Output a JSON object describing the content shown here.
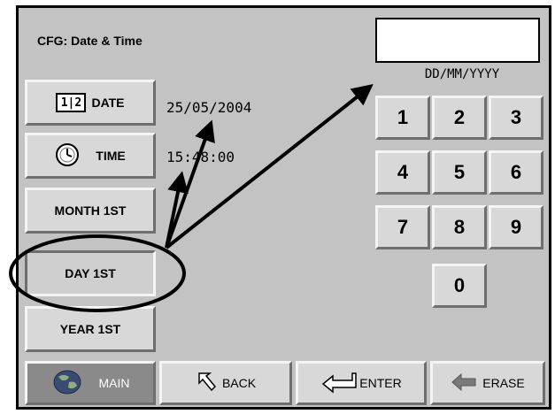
{
  "screen": {
    "title": "CFG: Date & Time",
    "entry_value": "",
    "format_hint": "DD/MM/YYYY"
  },
  "side_buttons": {
    "date": "DATE",
    "time": "TIME",
    "month_first": "MONTH 1ST",
    "day_first": "DAY 1ST",
    "year_first": "YEAR 1ST",
    "date_icon_text": "1|2"
  },
  "values": {
    "date": "25/05/2004",
    "time": "15:48:00"
  },
  "keypad": {
    "keys": [
      "1",
      "2",
      "3",
      "4",
      "5",
      "6",
      "7",
      "8",
      "9",
      "0"
    ]
  },
  "bottom_bar": {
    "main": "MAIN",
    "back": "BACK",
    "enter": "ENTER",
    "erase": "ERASE"
  }
}
